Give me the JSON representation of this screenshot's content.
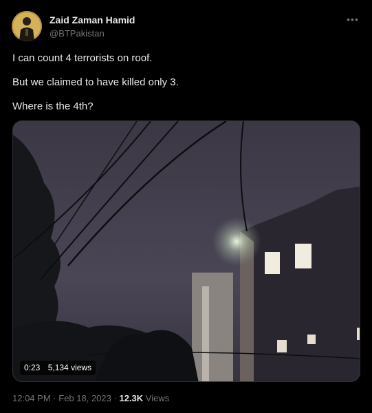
{
  "author": {
    "name": "Zaid Zaman Hamid",
    "handle": "@BTPakistan"
  },
  "tweet": {
    "lines": [
      "I can count 4 terrorists on roof.",
      "But we claimed to have killed only 3.",
      "Where is the 4th?"
    ]
  },
  "video": {
    "duration": "0:23",
    "views": "5,134 views"
  },
  "meta": {
    "time": "12:04 PM",
    "separator": "·",
    "date": "Feb 18, 2023",
    "view_count": "12.3K",
    "view_label": "Views"
  },
  "icons": {
    "more": "more-horizontal-icon"
  }
}
